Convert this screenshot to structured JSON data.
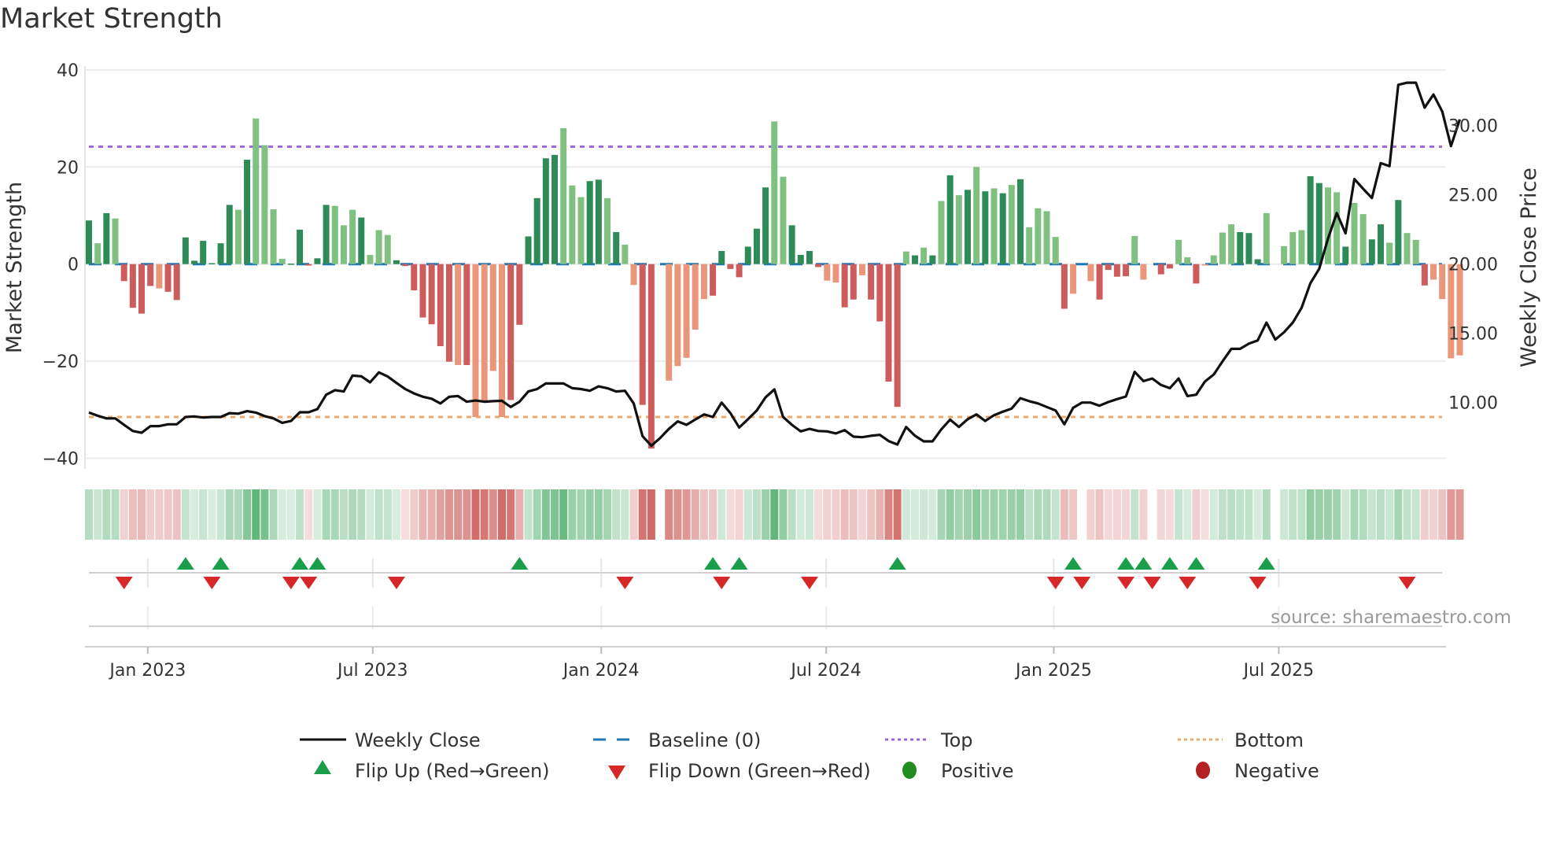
{
  "title": "Market Strength",
  "source": "source: sharemaestro.com",
  "legend": {
    "weekly_close": "Weekly Close",
    "baseline": "Baseline (0)",
    "top": "Top",
    "bottom": "Bottom",
    "flip_up": "Flip Up (Red→Green)",
    "flip_down": "Flip Down (Green→Red)",
    "positive": "Positive",
    "negative": "Negative"
  },
  "colors": {
    "bar_up_strong": "#2e8b57",
    "bar_up_weak": "#80c080",
    "bar_down_strong": "#cd5c5c",
    "bar_down_weak": "#e9967a",
    "line": "#111111",
    "baseline": "#1f77b4",
    "top": "#9966dd",
    "bottom": "#f0a868",
    "flip_up": "#1a9e4a",
    "flip_down": "#d62828",
    "positive": "#228b22",
    "negative": "#b22222"
  },
  "chart_data": {
    "type": "bar+line",
    "title": "Market Strength",
    "ylabel": "Market Strength",
    "y2label": "Weekly Close Price",
    "ylim": [
      -40,
      40
    ],
    "y2lim": [
      5.9,
      34.1
    ],
    "yticks": [
      "40",
      "20",
      "0",
      "−20",
      "−40"
    ],
    "ytick_values": [
      40,
      20,
      0,
      -20,
      -40
    ],
    "y2ticks": [
      "30.00",
      "25.00",
      "20.00",
      "15.00",
      "10.00"
    ],
    "y2tick_values": [
      30,
      25,
      20,
      15,
      10
    ],
    "xticks": [
      {
        "label": "Jan 2023",
        "week": 6.7
      },
      {
        "label": "Jul 2023",
        "week": 32.3
      },
      {
        "label": "Jan 2024",
        "week": 58.3
      },
      {
        "label": "Jul 2024",
        "week": 83.9
      },
      {
        "label": "Jan 2025",
        "week": 109.8
      },
      {
        "label": "Jul 2025",
        "week": 135.4
      }
    ],
    "top": 24.2,
    "bottom": -31.5,
    "baseline": 0,
    "strength": [
      9.0,
      4.3,
      10.5,
      9.4,
      -3.5,
      -9.0,
      -10.2,
      -4.5,
      -5.0,
      -5.7,
      -7.4,
      5.5,
      0.7,
      4.8,
      0.2,
      4.3,
      12.2,
      11.2,
      21.5,
      30.0,
      24.5,
      11.3,
      1.1,
      0.1,
      7.1,
      -0.3,
      1.2,
      12.2,
      12.0,
      8.0,
      11.2,
      9.6,
      1.9,
      7.0,
      6.0,
      0.8,
      -0.4,
      -5.4,
      -11.0,
      -12.4,
      -16.9,
      -20.1,
      -20.8,
      -20.8,
      -31.5,
      -28.3,
      -22.0,
      -31.5,
      -28.0,
      -12.5,
      5.7,
      13.6,
      21.8,
      22.5,
      28.0,
      16.2,
      13.8,
      17.1,
      17.4,
      13.6,
      6.6,
      4.0,
      -4.3,
      -29.0,
      -38.0,
      0,
      -24.0,
      -21.0,
      -19.3,
      -13.5,
      -7.2,
      -6.5,
      2.7,
      -1.0,
      -2.7,
      3.6,
      7.3,
      15.8,
      29.4,
      18.0,
      8.0,
      1.9,
      2.7,
      -0.6,
      -3.4,
      -3.8,
      -8.9,
      -7.3,
      -2.3,
      -7.3,
      -11.8,
      -24.2,
      -29.4,
      2.6,
      1.8,
      3.4,
      1.8,
      13.0,
      18.3,
      14.2,
      15.3,
      20.0,
      15.0,
      15.6,
      14.6,
      16.3,
      17.5,
      7.6,
      11.5,
      10.9,
      5.6,
      -9.2,
      -6.1,
      0,
      -3.5,
      -7.3,
      -1.2,
      -2.6,
      -2.5,
      5.8,
      -3.2,
      0,
      -2.1,
      -0.9,
      5.0,
      1.4,
      -4.0,
      -0.3,
      1.8,
      6.5,
      8.2,
      6.6,
      6.4,
      1.0,
      10.5,
      0,
      3.7,
      6.6,
      7.0,
      18.1,
      16.7,
      15.8,
      14.8,
      3.6,
      12.6,
      10.3,
      5.1,
      8.2,
      4.4,
      13.2,
      6.4,
      5.0,
      -4.4,
      -3.2,
      -7.2,
      -19.4,
      -18.8
    ],
    "strength_shade": "dldlddddlddddddddldlllldddddllldllldddddddldllllddddddlllddldlldddllllldddddddllddddllddlddddldldldldldldldlllldldlddddlldddlldlllldddlllllddlldllddldlldl",
    "weekly_close": [
      9.28,
      9.05,
      8.86,
      8.86,
      8.39,
      7.95,
      7.82,
      8.3,
      8.3,
      8.43,
      8.43,
      8.96,
      9.0,
      8.92,
      8.96,
      8.96,
      9.24,
      9.2,
      9.38,
      9.28,
      9.02,
      8.86,
      8.54,
      8.67,
      9.3,
      9.3,
      9.53,
      10.57,
      10.9,
      10.8,
      11.95,
      11.9,
      11.46,
      12.18,
      11.88,
      11.42,
      10.98,
      10.66,
      10.42,
      10.28,
      9.94,
      10.42,
      10.47,
      10.06,
      10.15,
      10.06,
      10.1,
      10.13,
      9.68,
      10.06,
      10.8,
      10.98,
      11.38,
      11.38,
      11.38,
      11.04,
      10.98,
      10.85,
      11.17,
      11.04,
      10.8,
      10.85,
      9.94,
      7.58,
      6.88,
      7.44,
      8.1,
      8.64,
      8.39,
      8.77,
      9.15,
      8.96,
      10.0,
      9.24,
      8.2,
      8.8,
      9.43,
      10.38,
      10.95,
      8.96,
      8.39,
      7.92,
      8.1,
      7.95,
      7.92,
      7.77,
      8.01,
      7.54,
      7.5,
      7.6,
      7.67,
      7.22,
      6.97,
      8.24,
      7.6,
      7.2,
      7.2,
      8.07,
      8.77,
      8.24,
      8.8,
      9.15,
      8.67,
      9.09,
      9.34,
      9.56,
      10.32,
      10.1,
      9.94,
      9.68,
      9.43,
      8.43,
      9.62,
      10.0,
      10.0,
      9.77,
      10.04,
      10.25,
      10.44,
      12.22,
      11.55,
      11.74,
      11.27,
      11.04,
      11.74,
      10.47,
      10.57,
      11.52,
      12.03,
      12.97,
      13.88,
      13.88,
      14.26,
      14.49,
      15.78,
      14.55,
      15.08,
      15.78,
      16.86,
      18.62,
      19.66,
      21.84,
      23.69,
      22.22,
      26.14,
      25.44,
      24.77,
      27.29,
      27.08,
      32.95,
      33.1,
      33.1,
      31.3,
      32.25,
      31.02,
      28.52,
      30.45
    ],
    "flip_up_weeks": [
      11,
      15,
      24,
      26,
      49,
      71,
      74,
      92,
      112,
      118,
      120,
      123,
      126,
      134
    ],
    "flip_down_weeks": [
      4,
      14,
      23,
      25,
      35,
      61,
      72,
      82,
      110,
      113,
      118,
      121,
      125,
      133,
      150
    ],
    "legend_position": "bottom"
  }
}
